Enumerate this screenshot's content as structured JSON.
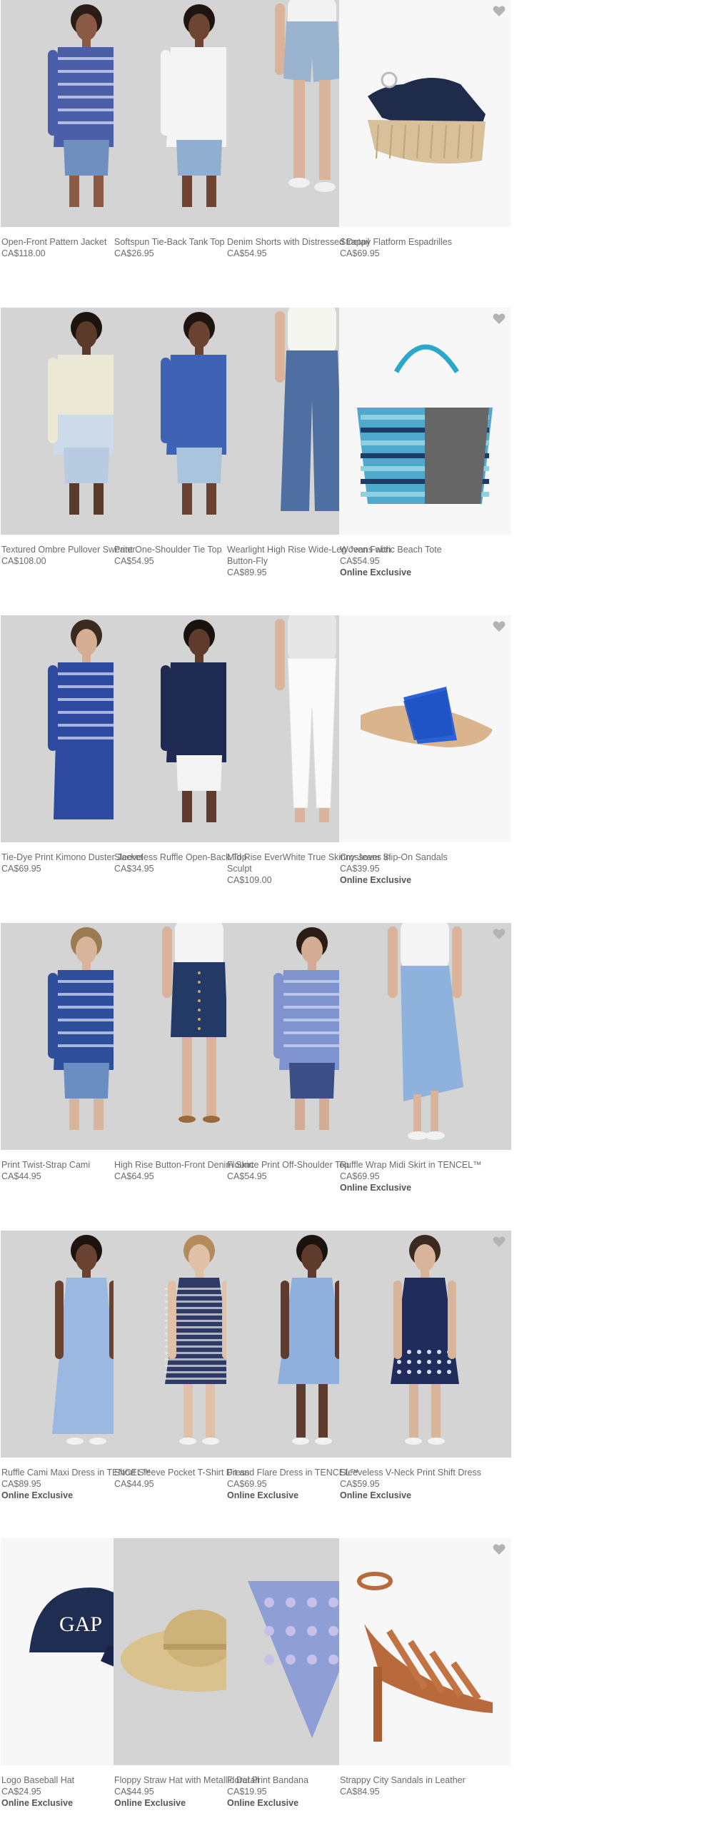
{
  "colors": {
    "photo_bg": "#d4d4d4",
    "product_bg": "#f7f7f7",
    "text": "#6b6b6b",
    "heart": "#b3b3b3"
  },
  "products": [
    {
      "name": "Open-Front Pattern Jacket",
      "price": "CA$118.00",
      "tag": "",
      "bg": "photo",
      "art": "person-jacket",
      "icon": "heart-icon"
    },
    {
      "name": "Softspun Tie-Back Tank Top",
      "price": "CA$26.95",
      "tag": "",
      "bg": "photo",
      "art": "person-tank",
      "icon": "heart-icon"
    },
    {
      "name": "Denim Shorts with Distressed Detail",
      "price": "CA$54.95",
      "tag": "",
      "bg": "photo",
      "art": "person-shorts",
      "icon": "heart-icon"
    },
    {
      "name": "Strappy Flatform Espadrilles",
      "price": "CA$69.95",
      "tag": "",
      "bg": "product",
      "art": "espadrille",
      "icon": "heart-icon"
    },
    {
      "name": "Textured Ombre Pullover Sweater",
      "price": "CA$108.00",
      "tag": "",
      "bg": "photo",
      "art": "person-sweater",
      "icon": "heart-icon"
    },
    {
      "name": "Print One-Shoulder Tie Top",
      "price": "CA$54.95",
      "tag": "",
      "bg": "photo",
      "art": "person-oneshoulder",
      "icon": "heart-icon"
    },
    {
      "name": "Wearlight High Rise Wide-Leg Jeans with Button-Fly",
      "price": "CA$89.95",
      "tag": "",
      "bg": "photo",
      "art": "person-widejeans",
      "icon": "heart-icon"
    },
    {
      "name": "Woven Fabric Beach Tote",
      "price": "CA$54.95",
      "tag": "Online Exclusive",
      "bg": "product",
      "art": "tote",
      "icon": "heart-icon"
    },
    {
      "name": "Tie-Dye Print Kimono Duster Jacket",
      "price": "CA$69.95",
      "tag": "",
      "bg": "photo",
      "art": "person-kimono",
      "icon": "heart-icon"
    },
    {
      "name": "Sleeveless Ruffle Open-Back Top",
      "price": "CA$34.95",
      "tag": "",
      "bg": "photo",
      "art": "person-ruffletop",
      "icon": "heart-icon"
    },
    {
      "name": "Mid Rise EverWhite True Skinny Jeans in Sculpt",
      "price": "CA$109.00",
      "tag": "",
      "bg": "photo",
      "art": "person-whitejeans",
      "icon": "heart-icon"
    },
    {
      "name": "Crossover Slip-On Sandals",
      "price": "CA$39.95",
      "tag": "Online Exclusive",
      "bg": "product",
      "art": "slide-sandal",
      "icon": "heart-icon"
    },
    {
      "name": "Print Twist-Strap Cami",
      "price": "CA$44.95",
      "tag": "",
      "bg": "photo",
      "art": "person-cami",
      "icon": "heart-icon"
    },
    {
      "name": "High Rise Button-Front Denim Skirt",
      "price": "CA$64.95",
      "tag": "",
      "bg": "photo",
      "art": "person-denimskirt",
      "icon": "heart-icon"
    },
    {
      "name": "Flounce Print Off-Shoulder Top",
      "price": "CA$54.95",
      "tag": "",
      "bg": "photo",
      "art": "person-offshoulder",
      "icon": "heart-icon"
    },
    {
      "name": "Ruffle Wrap Midi Skirt in TENCEL™",
      "price": "CA$69.95",
      "tag": "Online Exclusive",
      "bg": "photo",
      "art": "person-midiskirt",
      "icon": "heart-icon"
    },
    {
      "name": "Ruffle Cami Maxi Dress in TENCEL™",
      "price": "CA$89.95",
      "tag": "Online Exclusive",
      "bg": "photo",
      "art": "person-maxidress",
      "icon": "heart-icon"
    },
    {
      "name": "Short Sleeve Pocket T-Shirt Dress",
      "price": "CA$44.95",
      "tag": "",
      "bg": "photo",
      "art": "person-tshirtdress",
      "icon": "heart-icon"
    },
    {
      "name": "Fit and Flare Dress in TENCEL™",
      "price": "CA$69.95",
      "tag": "Online Exclusive",
      "bg": "photo",
      "art": "person-flaredress",
      "icon": "heart-icon"
    },
    {
      "name": "Sleeveless V-Neck Print Shift Dress",
      "price": "CA$59.95",
      "tag": "Online Exclusive",
      "bg": "photo",
      "art": "person-shiftdress",
      "icon": "heart-icon"
    },
    {
      "name": "Logo Baseball Hat",
      "price": "CA$24.95",
      "tag": "Online Exclusive",
      "bg": "product",
      "art": "baseball-hat",
      "icon": "heart-icon",
      "logo": "GAP"
    },
    {
      "name": "Floppy Straw Hat with Metallic Detail",
      "price": "CA$44.95",
      "tag": "Online Exclusive",
      "bg": "photo",
      "art": "straw-hat",
      "icon": "heart-icon"
    },
    {
      "name": "Floral Print Bandana",
      "price": "CA$19.95",
      "tag": "Online Exclusive",
      "bg": "photo",
      "art": "bandana",
      "icon": "heart-icon"
    },
    {
      "name": "Strappy City Sandals in Leather",
      "price": "CA$84.95",
      "tag": "",
      "bg": "product",
      "art": "heel-sandal",
      "icon": "heart-icon"
    }
  ]
}
